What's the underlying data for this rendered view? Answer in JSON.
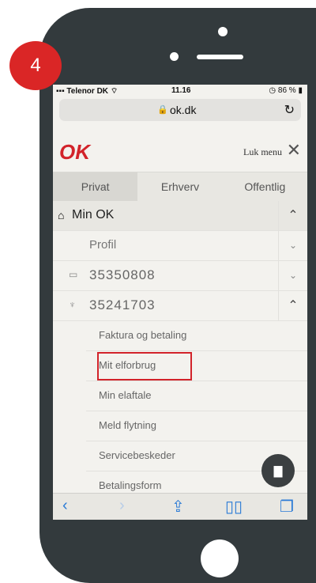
{
  "badge": "4",
  "statusbar": {
    "carrier": "Telenor DK",
    "time": "11.16",
    "battery": "86 %"
  },
  "browser": {
    "url": "ok.dk"
  },
  "header": {
    "logo": "OK",
    "close_label": "Luk menu"
  },
  "tabs": [
    {
      "label": "Privat"
    },
    {
      "label": "Erhverv"
    },
    {
      "label": "Offentlig"
    }
  ],
  "menu": {
    "min_ok": "Min OK",
    "profil": "Profil",
    "accounts": [
      {
        "number": "35350808"
      },
      {
        "number": "35241703"
      }
    ],
    "sub_items": [
      {
        "label": "Faktura og betaling"
      },
      {
        "label": "Mit elforbrug"
      },
      {
        "label": "Min elaftale"
      },
      {
        "label": "Meld flytning"
      },
      {
        "label": "Servicebeskeder"
      },
      {
        "label": "Betalingsform"
      }
    ]
  },
  "icons": {
    "home": "home-icon",
    "card": "card-icon",
    "plug": "plug-icon",
    "chat": "chat-icon",
    "lock": "lock-icon",
    "reload": "reload-icon"
  },
  "colors": {
    "brand": "#d2232a",
    "phone": "#333a3d",
    "ios_blue": "#2b7bd6"
  }
}
